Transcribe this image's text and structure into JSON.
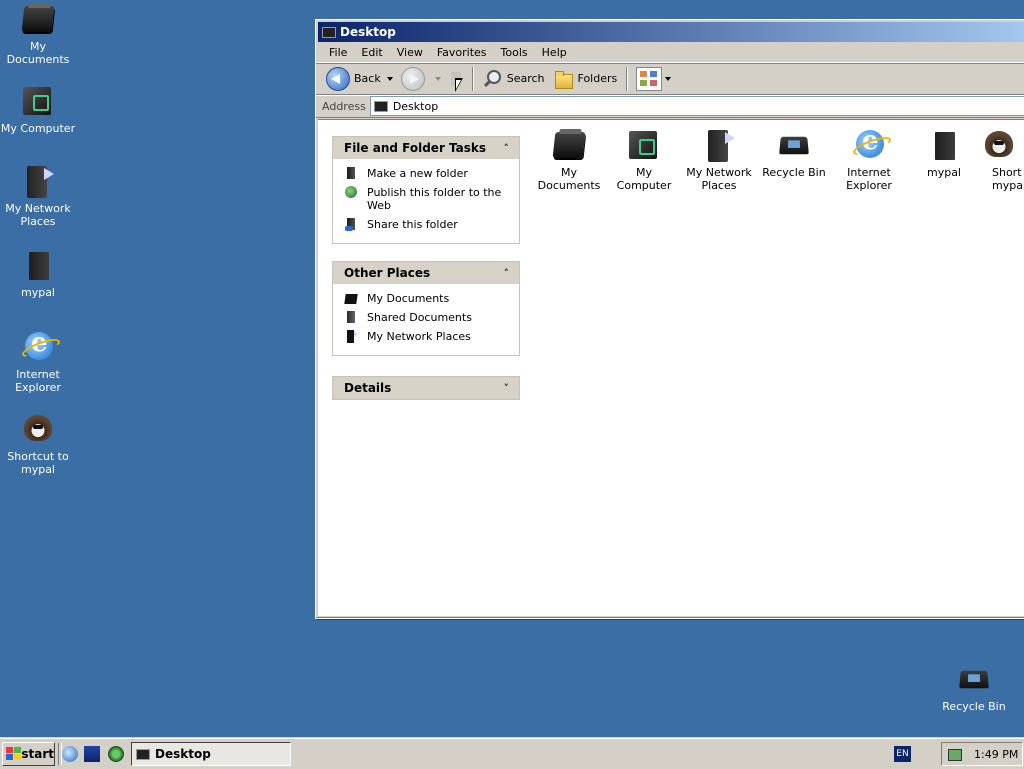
{
  "desktop": {
    "icons": [
      {
        "label": "My Documents",
        "icon": "my-documents-icon"
      },
      {
        "label": "My Computer",
        "icon": "my-computer-icon"
      },
      {
        "label": "My Network Places",
        "icon": "my-network-places-icon"
      },
      {
        "label": "mypal",
        "icon": "mypal-icon"
      },
      {
        "label": "Internet Explorer",
        "icon": "internet-explorer-icon"
      },
      {
        "label": "Shortcut to mypal",
        "icon": "shortcut-mypal-icon"
      },
      {
        "label": "Recycle Bin",
        "icon": "recycle-bin-icon"
      }
    ]
  },
  "window": {
    "title": "Desktop",
    "menu": [
      "File",
      "Edit",
      "View",
      "Favorites",
      "Tools",
      "Help"
    ],
    "toolbar": {
      "back": "Back",
      "search": "Search",
      "folders": "Folders"
    },
    "address": {
      "label": "Address",
      "value": "Desktop"
    },
    "panels": [
      {
        "title": "File and Folder Tasks",
        "items": [
          "Make a new folder",
          "Publish this folder to the Web",
          "Share this folder"
        ]
      },
      {
        "title": "Other Places",
        "items": [
          "My Documents",
          "Shared Documents",
          "My Network Places"
        ]
      },
      {
        "title": "Details",
        "items": []
      }
    ],
    "files": [
      {
        "label": "My Documents"
      },
      {
        "label": "My Computer"
      },
      {
        "label": "My Network Places"
      },
      {
        "label": "Recycle Bin"
      },
      {
        "label": "Internet Explorer"
      },
      {
        "label": "mypal"
      },
      {
        "label": "Shortcut to mypal"
      }
    ]
  },
  "taskbar": {
    "start": "start",
    "active_window": "Desktop",
    "language": "EN",
    "clock": "1:49 PM"
  },
  "colors": {
    "desktop": "#3a6ea5",
    "titlebar_start": "#0a246a",
    "titlebar_end": "#a6caf0"
  }
}
